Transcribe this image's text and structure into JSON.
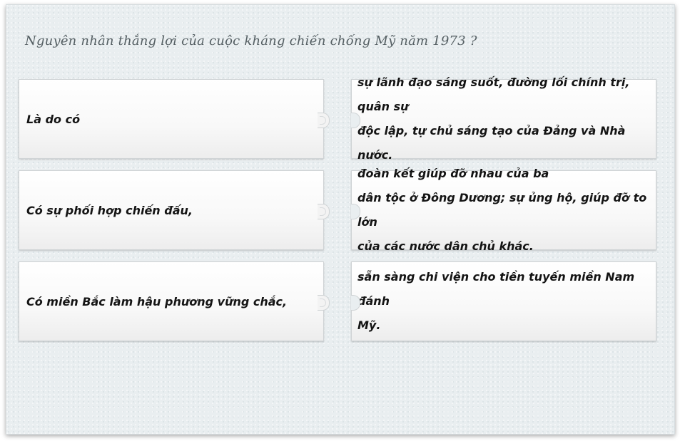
{
  "question": "Nguyên nhân thắng lợi của cuộc kháng chiến chống Mỹ năm 1973 ?",
  "pairs": [
    {
      "left": "Là do có",
      "right": "sự lãnh đạo sáng suốt, đường lối chính trị, quân sự\nđộc lập, tự chủ sáng tạo của Đảng và Nhà nước."
    },
    {
      "left": "Có sự phối hợp chiến đấu,",
      "right": "đoàn kết giúp đỡ nhau của ba\ndân tộc ở Đông Dương; sự ủng hộ, giúp đỡ to lớn\ncủa các nước dân chủ khác."
    },
    {
      "left": "Có miền Bắc làm hậu phương vững chắc,",
      "right": "sẵn sàng chi viện cho tiền tuyến miền Nam đánh\nMỹ."
    }
  ]
}
